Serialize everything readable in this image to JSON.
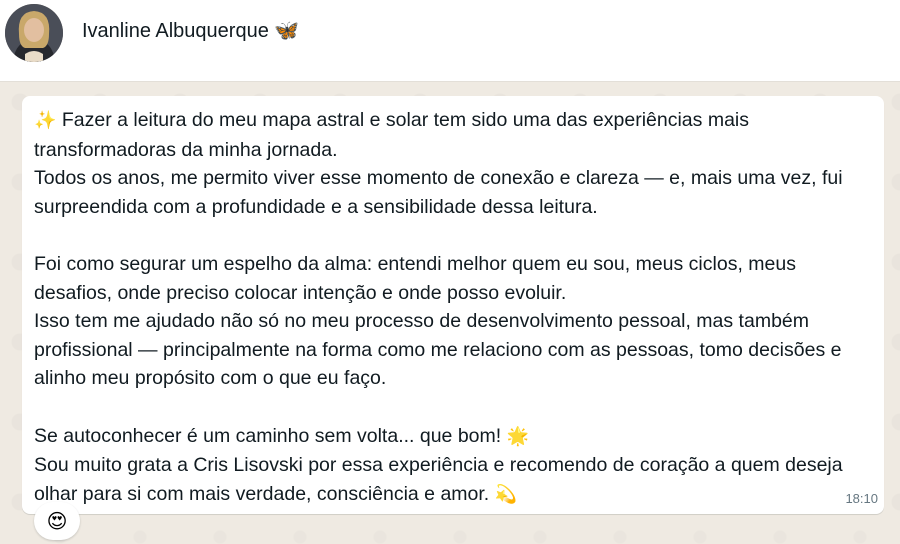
{
  "header": {
    "contact_name": "Ivanline Albuquerque 🦋"
  },
  "message": {
    "p1_emoji": "✨",
    "p1_line1": "Fazer a leitura do meu mapa astral e solar tem sido uma das experiências mais transformadoras da minha jornada.",
    "p1_line2": "Todos os anos, me permito viver esse momento de conexão e clareza — e, mais uma vez, fui surpreendida com a profundidade e a sensibilidade dessa leitura.",
    "p2_line1": "Foi como segurar um espelho da alma: entendi melhor quem eu sou, meus ciclos, meus desafios, onde preciso colocar intenção e onde posso evoluir.",
    "p2_line2": "Isso tem me ajudado não só no meu processo de desenvolvimento pessoal, mas também profissional — principalmente na forma como me relaciono com as pessoas, tomo decisões e alinho meu propósito com o que eu faço.",
    "p3_line1": "Se autoconhecer é um caminho sem volta... que bom!",
    "p3_line1_emoji": "🌟",
    "p3_line2": "Sou muito grata a Cris  Lisovski por essa experiência e recomendo de coração a quem deseja olhar para si com mais verdade, consciência e amor.",
    "p3_line2_emoji": "💫",
    "time": "18:10",
    "reaction": "😍"
  }
}
